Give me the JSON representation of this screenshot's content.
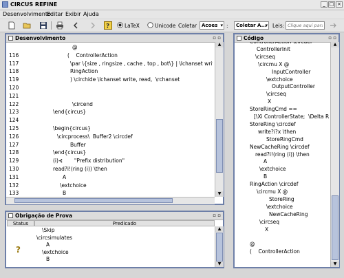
{
  "window": {
    "title": "CIRCUS REFINE"
  },
  "menu": [
    "Desenvolvimento",
    "Editar",
    "Exibir",
    "Ajuda"
  ],
  "toolbar": {
    "latex_label": "LaTeX",
    "unicode_label": "Unicode",
    "coletar_label": "Coletar",
    "acoes_value": "Acoes",
    "coletar_combo_value": "Coletar A...",
    "leis_label": "Leis:",
    "search_placeholder": "Clique aqui para se",
    "selected_format": "LaTeX"
  },
  "dev_panel": {
    "title": "Desenvolvimento",
    "lines": [
      {
        "num": "",
        "text": "@"
      },
      {
        "num": "116",
        "text": "(    ControllerAction"
      },
      {
        "num": "117",
        "text": "\\par \\{size , ringsize , cache , top , bot\\} | \\lchanset write, read,  \\r"
      },
      {
        "num": "118",
        "text": "RingAction"
      },
      {
        "num": "119",
        "text": ") \\circhide \\lchanset write, read,  \\rchanset"
      },
      {
        "num": "120",
        "text": ""
      },
      {
        "num": "121",
        "text": ""
      },
      {
        "num": "122",
        "text": "\\circend"
      },
      {
        "num": "123",
        "text": "\\end{circus}"
      },
      {
        "num": "124",
        "text": ""
      },
      {
        "num": "125",
        "text": "\\begin{circus}"
      },
      {
        "num": "126",
        "text": "\\circprocess\\  Buffer2 \\circdef"
      },
      {
        "num": "127",
        "text": "Buffer"
      },
      {
        "num": "128",
        "text": "\\end{circus}"
      },
      {
        "num": "129",
        "text": "(i)⊰       \"Prefix distribution\""
      },
      {
        "num": "130",
        "text": "read?i!(ring (i)) \\then"
      },
      {
        "num": "131",
        "text": "A"
      },
      {
        "num": "132",
        "text": "\\extchoice"
      },
      {
        "num": "133",
        "text": "B"
      }
    ]
  },
  "proof_panel": {
    "title": "Obrigação de Prova",
    "col_status": "Status",
    "col_predicado": "Predicado",
    "lines": [
      "\\Skip",
      "\\circsimulates",
      "A",
      "\\extchoice",
      "B"
    ],
    "status_icon": "question-icon"
  },
  "code_panel": {
    "title": "Código",
    "lines": [
      "ControllerAction \\circdef",
      "ControllerInit",
      "\\circseq",
      "\\circmu X @",
      "InputController",
      "\\extchoice",
      "OutputController",
      "\\circseq",
      "X",
      "StoreRingCmd ==",
      "[\\Xi ControllerState;  \\Delta R",
      "StoreRing \\circdef",
      "write?i?x \\then",
      "StoreRingCmd",
      "NewCacheRing \\circdef",
      "read?i!(ring (i)) \\then",
      "A",
      "\\extchoice",
      "B",
      "RingAction \\circdef",
      "\\circmu X @",
      "StoreRing",
      "\\extchoice",
      "NewCacheRing",
      "\\circseq",
      "X",
      "",
      "@",
      "(    ControllerAction"
    ]
  },
  "colors": {
    "panel_border": "#6d7fa8",
    "scroll_thumb": "#b7c3dc"
  }
}
